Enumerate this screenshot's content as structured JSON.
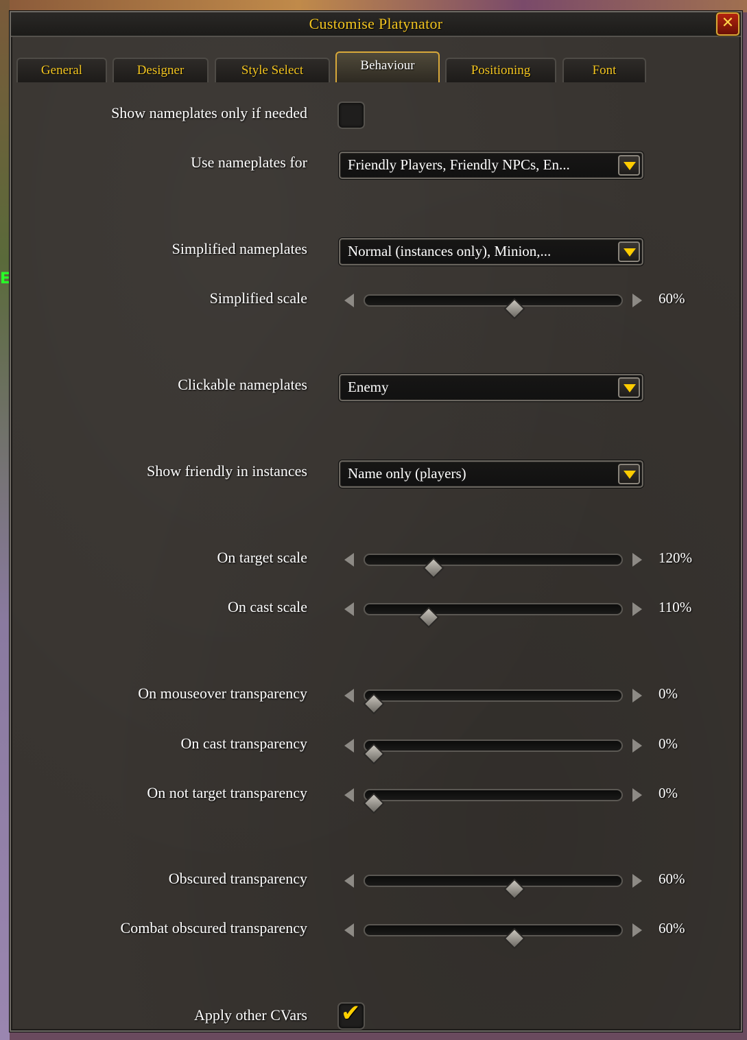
{
  "window": {
    "title": "Customise Platynator",
    "close_label": "✕"
  },
  "background_text": "E",
  "tabs": [
    {
      "label": "General",
      "active": false
    },
    {
      "label": "Designer",
      "active": false
    },
    {
      "label": "Style Select",
      "active": false
    },
    {
      "label": "Behaviour",
      "active": true
    },
    {
      "label": "Positioning",
      "active": false
    },
    {
      "label": "Font",
      "active": false
    }
  ],
  "settings": {
    "show_only_if_needed": {
      "label": "Show nameplates only if needed",
      "checked": false
    },
    "use_nameplates_for": {
      "label": "Use nameplates for",
      "value": "Friendly Players, Friendly NPCs, En..."
    },
    "simplified_nameplates": {
      "label": "Simplified nameplates",
      "value": "Normal (instances only), Minion,..."
    },
    "simplified_scale": {
      "label": "Simplified scale",
      "value_text": "60%",
      "level": 0.59
    },
    "clickable_nameplates": {
      "label": "Clickable nameplates",
      "value": "Enemy"
    },
    "show_friendly_in_instances": {
      "label": "Show friendly in instances",
      "value": "Name only (players)"
    },
    "on_target_scale": {
      "label": "On target scale",
      "value_text": "120%",
      "level": 0.25
    },
    "on_cast_scale": {
      "label": "On cast scale",
      "value_text": "110%",
      "level": 0.23
    },
    "on_mouseover_transparency": {
      "label": "On mouseover transparency",
      "value_text": "0%",
      "level": 0.0
    },
    "on_cast_transparency": {
      "label": "On cast transparency",
      "value_text": "0%",
      "level": 0.0
    },
    "on_not_target_transparency": {
      "label": "On not target transparency",
      "value_text": "0%",
      "level": 0.0
    },
    "obscured_transparency": {
      "label": "Obscured transparency",
      "value_text": "60%",
      "level": 0.59
    },
    "combat_obscured_transparency": {
      "label": "Combat obscured transparency",
      "value_text": "60%",
      "level": 0.59
    },
    "apply_other_cvars": {
      "label": "Apply other CVars",
      "checked": true
    }
  },
  "colors": {
    "accent_gold": "#f3c520",
    "check_yellow": "#ffd000"
  }
}
